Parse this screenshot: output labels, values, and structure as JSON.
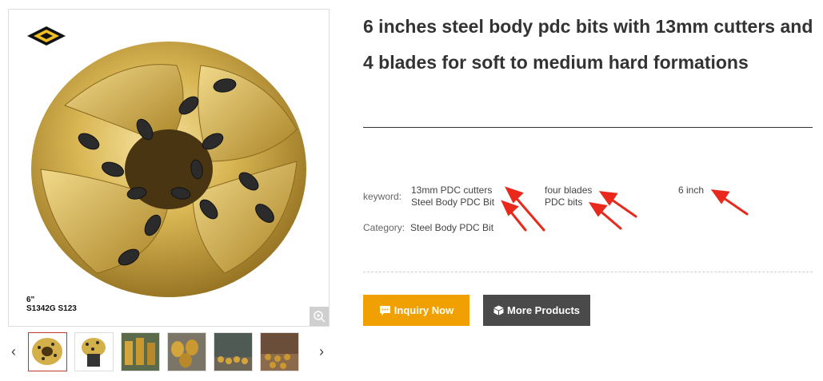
{
  "product": {
    "title": "6 inches steel body pdc bits with 13mm cutters and 4 blades for soft to medium hard formations",
    "image_caption_line1": "6\"",
    "image_caption_line2": "S1342G S123",
    "keyword_label": "keyword:",
    "keywords": [
      "13mm PDC cutters",
      "Steel Body PDC Bit",
      "four blades",
      "PDC bits",
      "6 inch"
    ],
    "category_label": "Category:",
    "category_value": "Steel Body PDC Bit"
  },
  "buttons": {
    "inquiry_label": "Inquiry Now",
    "more_label": "More Products"
  },
  "gallery": {
    "prev_glyph": "‹",
    "next_glyph": "›",
    "thumbnail_count": 6,
    "active_index": 0
  },
  "colors": {
    "inquiry_button": "#f0a000",
    "more_button": "#4a4a4a",
    "annotation_arrow": "#e8291c",
    "bit_gold": "#d4b04a"
  }
}
